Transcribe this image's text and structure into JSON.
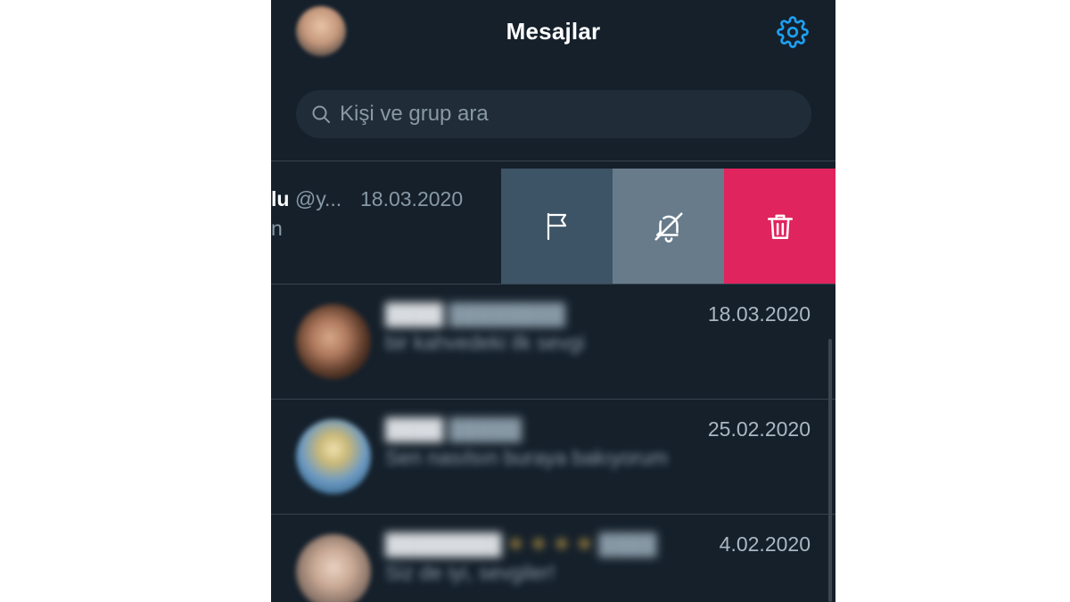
{
  "header": {
    "title": "Mesajlar",
    "avatar_icon": "profile-avatar",
    "settings_icon": "gear-icon"
  },
  "search": {
    "placeholder": "Kişi ve grup ara",
    "icon": "search-icon"
  },
  "swiped_conversation": {
    "name_fragment": "lu",
    "handle_fragment": "@y...",
    "date": "18.03.2020",
    "preview_fragment": "n",
    "actions": [
      {
        "name": "report",
        "icon": "flag-icon",
        "color": "#3d5466"
      },
      {
        "name": "mute",
        "icon": "bell-off-icon",
        "color": "#687b8b"
      },
      {
        "name": "delete",
        "icon": "trash-icon",
        "color": "#e0245e"
      }
    ]
  },
  "conversations": [
    {
      "date": "18.03.2020",
      "blurred_preview": "bir kahvedeki ilk sevgi"
    },
    {
      "date": "25.02.2020",
      "blurred_preview": "Sen nasılsın buraya bakıyorum"
    },
    {
      "date": "4.02.2020",
      "blurred_preview": "Siz de iyi, sevgiler!"
    }
  ],
  "colors": {
    "background": "#15202b",
    "accent": "#1da1f2",
    "delete": "#e0245e"
  }
}
